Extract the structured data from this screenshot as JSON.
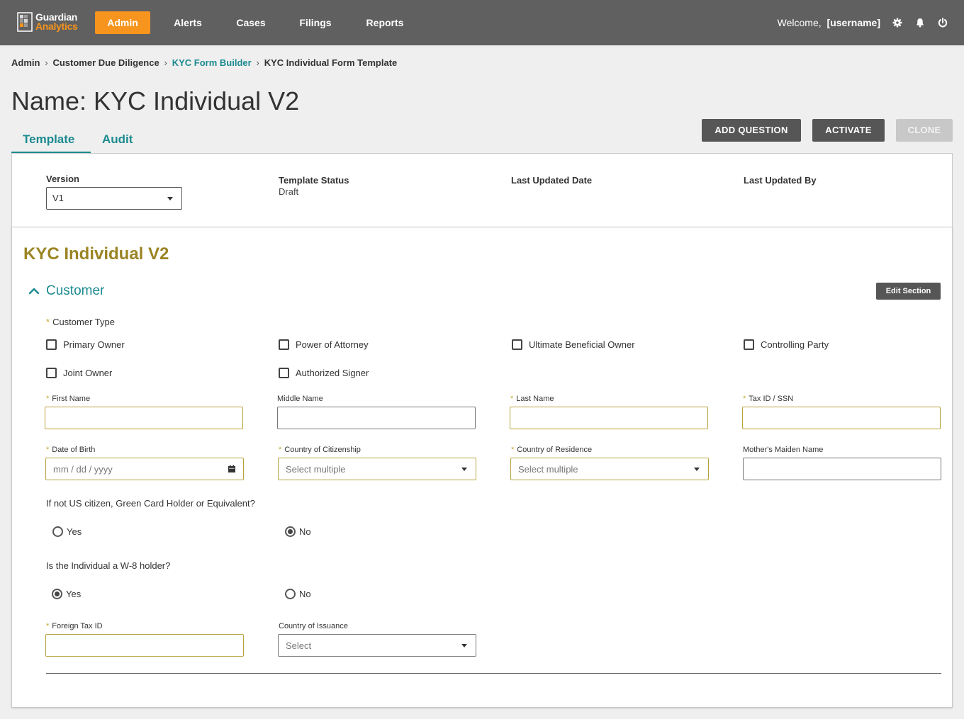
{
  "logo": {
    "line1": "Guardian",
    "line2": "Analytics"
  },
  "nav": {
    "items": [
      {
        "label": "Admin",
        "active": true
      },
      {
        "label": "Alerts"
      },
      {
        "label": "Cases"
      },
      {
        "label": "Filings"
      },
      {
        "label": "Reports"
      }
    ],
    "welcome": "Welcome,",
    "username": "[username]",
    "icons": [
      "gear-icon",
      "bell-icon",
      "power-icon"
    ]
  },
  "breadcrumb": [
    "Admin",
    "Customer Due Diligence",
    "KYC Form Builder",
    "KYC Individual Form Template"
  ],
  "page_title": "Name: KYC Individual V2",
  "tabs": [
    "Template",
    "Audit"
  ],
  "actions": {
    "add_question": "ADD QUESTION",
    "activate": "ACTIVATE",
    "clone": "CLONE"
  },
  "meta": {
    "version_label": "Version",
    "version_value": "V1",
    "status_label": "Template Status",
    "status_value": "Draft",
    "updated_date_label": "Last Updated Date",
    "updated_by_label": "Last Updated By"
  },
  "form": {
    "title": "KYC Individual V2",
    "section": "Customer",
    "edit_section": "Edit Section",
    "customer_type_label": "Customer Type",
    "customer_types": [
      "Primary Owner",
      "Power of Attorney",
      "Ultimate Beneficial Owner",
      "Controlling Party",
      "Joint Owner",
      "Authorized Signer"
    ],
    "required_mark": "*",
    "fields": {
      "first_name": "First Name",
      "middle_name": "Middle Name",
      "last_name": "Last Name",
      "tax_id": "Tax ID / SSN",
      "dob": "Date of Birth",
      "dob_placeholder": "mm / dd / yyyy",
      "citizenship": "Country of Citizenship",
      "residence": "Country of Residence",
      "select_multiple": "Select multiple",
      "maiden_name": "Mother's Maiden Name",
      "foreign_tax_id": "Foreign Tax ID",
      "country_issuance": "Country of Issuance",
      "select": "Select"
    },
    "q1": {
      "label": "If not US citizen, Green Card Holder or Equivalent?",
      "yes": "Yes",
      "no": "No",
      "selected": "No"
    },
    "q2": {
      "label": "Is the Individual a W-8 holder?",
      "yes": "Yes",
      "no": "No",
      "selected": "Yes"
    }
  },
  "colors": {
    "nav_bg": "#606060",
    "accent_orange": "#f7941d",
    "teal": "#1b8a8f",
    "gold": "#9b8424"
  }
}
